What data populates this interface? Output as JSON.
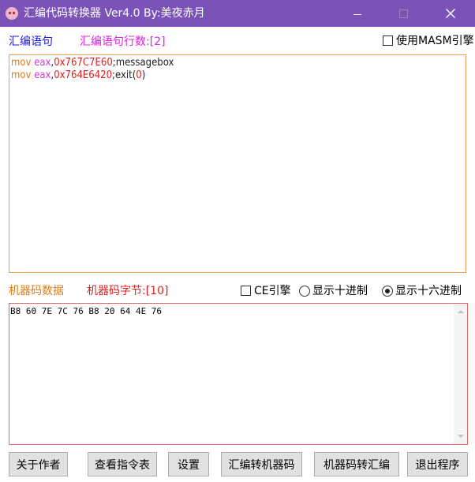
{
  "window": {
    "title": "汇编代码转换器 Ver4.0  By:美夜赤月",
    "icon": "app-face-icon"
  },
  "asm_section": {
    "label": "汇编语句",
    "count_label": "汇编语句行数:[2]",
    "masm_checkbox_label": "使用MASM引擎",
    "masm_checked": false,
    "lines": [
      {
        "mnemonic": "mov",
        "register": "eax",
        "sep": ",",
        "value": "0x767C7E60",
        "comment": ";messagebox"
      },
      {
        "mnemonic": "mov",
        "register": "eax",
        "sep": ",",
        "value": "0x764E6420",
        "comment_pre": ";exit(",
        "comment_num": "0",
        "comment_post": ")"
      }
    ]
  },
  "machine_section": {
    "label": "机器码数据",
    "bytes_label": "机器码字节:[10]",
    "ce_checkbox_label": "CE引擎",
    "ce_checked": false,
    "radio_decimal_label": "显示十进制",
    "radio_hex_label": "显示十六进制",
    "selected_radix": "hex",
    "hex_output": "B8 60 7E 7C 76 B8 20 64 4E 76"
  },
  "buttons": {
    "about": "关于作者",
    "instructions": "查看指令表",
    "settings": "设置",
    "asm_to_machine": "汇编转机器码",
    "machine_to_asm": "机器码转汇编",
    "exit": "退出程序"
  },
  "colors": {
    "titlebar": "#7b52b8",
    "asm_label": "#1a1ae0",
    "asm_count": "#e020e0",
    "machine_label": "#e07b1a",
    "machine_bytes": "#e02020"
  }
}
